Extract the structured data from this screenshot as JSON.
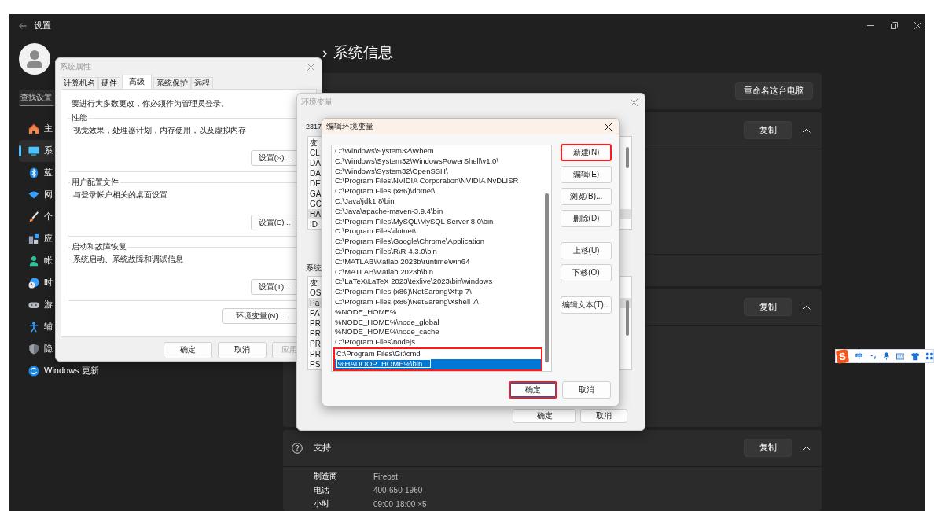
{
  "settings": {
    "title": "设置",
    "search": {
      "placeholder": "查找设置"
    },
    "nav": [
      {
        "label": "主",
        "selected": false
      },
      {
        "label": "系",
        "selected": true
      },
      {
        "label": "蓝",
        "selected": false
      },
      {
        "label": "网",
        "selected": false
      },
      {
        "label": "个",
        "selected": false
      },
      {
        "label": "应",
        "selected": false
      },
      {
        "label": "帐",
        "selected": false
      },
      {
        "label": "时",
        "selected": false
      },
      {
        "label": "游",
        "selected": false
      },
      {
        "label": "辅",
        "selected": false
      },
      {
        "label": "隐",
        "selected": false
      },
      {
        "label": "Windows 更新",
        "selected": false
      }
    ],
    "breadcrumb": {
      "separator": "›",
      "current": "系统信息"
    },
    "device_card": {
      "button": "重命名这台电脑"
    },
    "spec_cards": [
      {
        "button": "复制",
        "expanded": true
      },
      {
        "button": "复制",
        "expanded": true
      }
    ],
    "support": {
      "title": "支持",
      "button": "复制",
      "expanded": true,
      "rows": [
        {
          "label": "制造商",
          "value": "Firebat"
        },
        {
          "label": "电话",
          "value": "400-650-1960"
        },
        {
          "label": "小时",
          "value": "09:00-18:00 ×5"
        }
      ]
    }
  },
  "ime_bar": {
    "logo": "S",
    "mode": "中"
  },
  "system_properties": {
    "title": "系统属性",
    "tabs": [
      {
        "label": "计算机名",
        "selected": false
      },
      {
        "label": "硬件",
        "selected": false
      },
      {
        "label": "高级",
        "selected": true
      },
      {
        "label": "系统保护",
        "selected": false
      },
      {
        "label": "远程",
        "selected": false
      }
    ],
    "notice": "要进行大多数更改，你必须作为管理员登录。",
    "groups": [
      {
        "title": "性能",
        "description": "视觉效果，处理器计划，内存使用，以及虚拟内存",
        "button": "设置(S)..."
      },
      {
        "title": "用户配置文件",
        "description": "与登录帐户相关的桌面设置",
        "button": "设置(E)..."
      },
      {
        "title": "启动和故障恢复",
        "description": "系统启动、系统故障和调试信息",
        "button": "设置(T)..."
      }
    ],
    "env_button": "环境变量(N)...",
    "buttons": [
      {
        "label": "确定",
        "disabled": false
      },
      {
        "label": "取消",
        "disabled": false
      },
      {
        "label": "应用",
        "disabled": true
      }
    ]
  },
  "environment_variables": {
    "title": "环境变量",
    "user_label": "2317",
    "user_vars": [
      {
        "name": "变",
        "selected": false
      },
      {
        "name": "CL",
        "selected": false
      },
      {
        "name": "DA",
        "selected": false
      },
      {
        "name": "DA",
        "selected": false
      },
      {
        "name": "DE",
        "selected": false
      },
      {
        "name": "GA",
        "selected": false
      },
      {
        "name": "GC",
        "selected": false
      },
      {
        "name": "HA",
        "selected": true
      },
      {
        "name": "ID",
        "selected": false
      }
    ],
    "system_label": "系统",
    "system_vars": [
      {
        "name": "变",
        "selected": false
      },
      {
        "name": "OS",
        "selected": false
      },
      {
        "name": "Pa",
        "selected": true
      },
      {
        "name": "PA",
        "selected": false
      },
      {
        "name": "PR",
        "selected": false
      },
      {
        "name": "PR",
        "selected": false
      },
      {
        "name": "PR",
        "selected": false
      },
      {
        "name": "PR",
        "selected": false
      },
      {
        "name": "PS",
        "selected": false
      }
    ],
    "buttons": [
      "确定",
      "取消"
    ]
  },
  "edit_dialog": {
    "title": "编辑环境变量",
    "paths": [
      {
        "text": "C:\\Windows\\System32\\Wbem",
        "selected": false,
        "editing": false,
        "highlighted": false
      },
      {
        "text": "C:\\Windows\\System32\\WindowsPowerShell\\v1.0\\",
        "selected": false,
        "editing": false,
        "highlighted": false
      },
      {
        "text": "C:\\Windows\\System32\\OpenSSH\\",
        "selected": false,
        "editing": false,
        "highlighted": false
      },
      {
        "text": "C:\\Program Files\\NVIDIA Corporation\\NVIDIA NvDLISR",
        "selected": false,
        "editing": false,
        "highlighted": false
      },
      {
        "text": "C:\\Program Files (x86)\\dotnet\\",
        "selected": false,
        "editing": false,
        "highlighted": false
      },
      {
        "text": "C:\\Java\\jdk1.8\\bin",
        "selected": false,
        "editing": false,
        "highlighted": false
      },
      {
        "text": "C:\\Java\\apache-maven-3.9.4\\bin",
        "selected": false,
        "editing": false,
        "highlighted": false
      },
      {
        "text": "C:\\Program Files\\MySQL\\MySQL Server 8.0\\bin",
        "selected": false,
        "editing": false,
        "highlighted": false
      },
      {
        "text": "C:\\Program Files\\dotnet\\",
        "selected": false,
        "editing": false,
        "highlighted": false
      },
      {
        "text": "C:\\Program Files\\Google\\Chrome\\Application",
        "selected": false,
        "editing": false,
        "highlighted": false
      },
      {
        "text": "C:\\Program Files\\R\\R-4.3.0\\bin",
        "selected": false,
        "editing": false,
        "highlighted": false
      },
      {
        "text": "C:\\MATLAB\\Matlab 2023b\\runtime\\win64",
        "selected": false,
        "editing": false,
        "highlighted": false
      },
      {
        "text": "C:\\MATLAB\\Matlab 2023b\\bin",
        "selected": false,
        "editing": false,
        "highlighted": false
      },
      {
        "text": "C:\\LaTeX\\LaTeX 2023\\texlive\\2023\\bin\\windows",
        "selected": false,
        "editing": false,
        "highlighted": false
      },
      {
        "text": "C:\\Program Files (x86)\\NetSarang\\Xftp 7\\",
        "selected": false,
        "editing": false,
        "highlighted": false
      },
      {
        "text": "C:\\Program Files (x86)\\NetSarang\\Xshell 7\\",
        "selected": false,
        "editing": false,
        "highlighted": false
      },
      {
        "text": "%NODE_HOME%",
        "selected": false,
        "editing": false,
        "highlighted": false
      },
      {
        "text": "%NODE_HOME%\\node_global",
        "selected": false,
        "editing": false,
        "highlighted": false
      },
      {
        "text": "%NODE_HOME%\\node_cache",
        "selected": false,
        "editing": false,
        "highlighted": false
      },
      {
        "text": "C:\\Program Files\\nodejs",
        "selected": false,
        "editing": false,
        "highlighted": false
      },
      {
        "text": "C:\\Program Files\\Git\\cmd",
        "selected": false,
        "editing": false,
        "highlighted": true
      },
      {
        "text": "%HADOOP_HOME%\\bin",
        "selected": true,
        "editing": true,
        "highlighted": true
      }
    ],
    "side_button_groups": [
      [
        {
          "label": "新建(N)",
          "highlighted": true
        },
        {
          "label": "编辑(E)",
          "highlighted": false
        },
        {
          "label": "浏览(B)...",
          "highlighted": false
        },
        {
          "label": "删除(D)",
          "highlighted": false
        }
      ],
      [
        {
          "label": "上移(U)",
          "highlighted": false
        },
        {
          "label": "下移(O)",
          "highlighted": false
        }
      ],
      [
        {
          "label": "编辑文本(T)...",
          "highlighted": false
        }
      ]
    ],
    "buttons": [
      {
        "label": "确定",
        "default": true,
        "highlighted": true
      },
      {
        "label": "取消",
        "default": false,
        "highlighted": false
      }
    ]
  }
}
